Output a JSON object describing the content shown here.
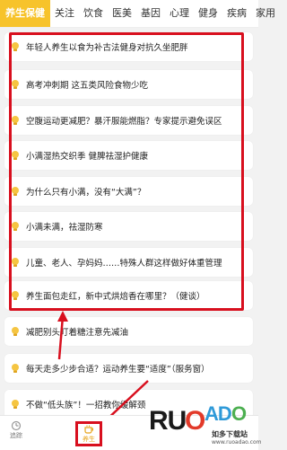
{
  "tabs": [
    "养生保健",
    "关注",
    "饮食",
    "医美",
    "基因",
    "心理",
    "健身",
    "疾病",
    "家用"
  ],
  "articles": [
    "年轻人养生以食为补古法健身对抗久坐肥胖",
    "高考冲刺期 这五类风险食物少吃",
    "空腹运动更减肥？暴汗服能燃脂？专家提示避免误区",
    "小满湿热交织季 健脾祛湿护健康",
    "为什么只有小满，没有“大满”？",
    "小满未满，祛湿防寒",
    "儿童、老人、孕妈妈……特殊人群这样做好体重管理",
    "养生面包走红，新中式烘焙香在哪里？（健谈）",
    "减肥别头盯着糖注意先减油",
    "每天走多少步合适？运动养生要“适度”（服务窗）",
    "不做“低头族”！一招教你缓解颈"
  ],
  "bottom_nav": [
    {
      "label": "追踪",
      "icon": "tracker-icon"
    },
    {
      "label": "养生",
      "icon": "wellness-icon"
    }
  ],
  "watermark": {
    "brand": "RUOADAO",
    "sub": "如多下载站",
    "url": "www.ruoadao.com"
  },
  "colors": {
    "accent": "#f7c32b",
    "highlight": "#d80f1e",
    "bulb": "#f5c542"
  }
}
